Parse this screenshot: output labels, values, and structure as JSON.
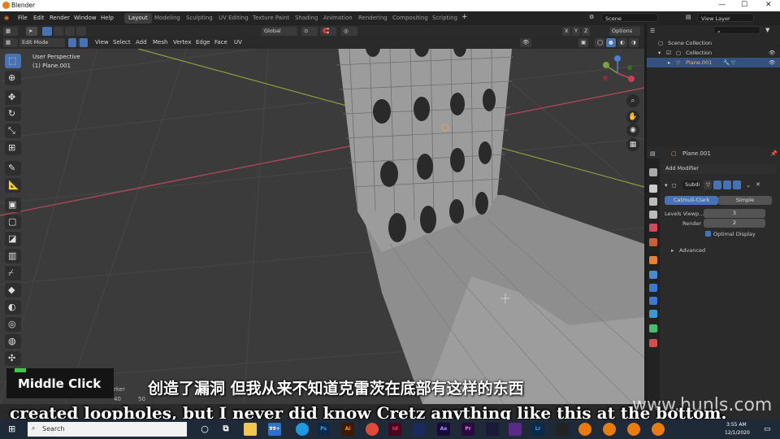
{
  "window": {
    "title": "Blender"
  },
  "menu": [
    "File",
    "Edit",
    "Render",
    "Window",
    "Help"
  ],
  "workspaces": [
    "Layout",
    "Modeling",
    "Sculpting",
    "UV Editing",
    "Texture Paint",
    "Shading",
    "Animation",
    "Rendering",
    "Compositing",
    "Scripting"
  ],
  "active_workspace": "Layout",
  "scene": {
    "scene_name": "Scene",
    "view_layer": "View Layer"
  },
  "viewport_header": {
    "transform_orientation": "Global",
    "options_label": "Options",
    "mode": "Edit Mode",
    "menus": [
      "View",
      "Select",
      "Add",
      "Mesh",
      "Vertex",
      "Edge",
      "Face",
      "UV"
    ]
  },
  "viewport": {
    "perspective": "User Perspective",
    "object_label": "(1) Plane.001"
  },
  "outliner": {
    "root": "Scene Collection",
    "collection": "Collection",
    "object": "Plane.001"
  },
  "properties": {
    "object_name": "Plane.001",
    "add_modifier": "Add Modifier",
    "modifier_name": "Subdi",
    "subdiv_types": [
      "Catmull-Clark",
      "Simple"
    ],
    "levels_viewport_label": "Levels Viewp...",
    "levels_viewport": "3",
    "render_label": "Render",
    "render_levels": "2",
    "optimal_display": "Optimal Display",
    "advanced": "Advanced"
  },
  "overlay": {
    "middle_click": "Middle Click",
    "subtitle_cn": "创造了漏洞 但我从来不知道克雷茨在底部有这样的东西",
    "subtitle_en": "created loopholes, but I never did know Cretz anything like this at the bottom.",
    "watermark": "www.hunls.com"
  },
  "timeline": {
    "marker_label": "rker",
    "frames": [
      "40",
      "50"
    ]
  },
  "taskbar": {
    "search_placeholder": "Search",
    "time": "3:55 AM",
    "date": "12/1/2020",
    "badge": "99+"
  },
  "colors": {
    "accent": "#4772b3",
    "selected_row": "#335080",
    "x_axis": "#c45060",
    "y_axis": "#9eb240",
    "brand": "#e87d0d"
  }
}
